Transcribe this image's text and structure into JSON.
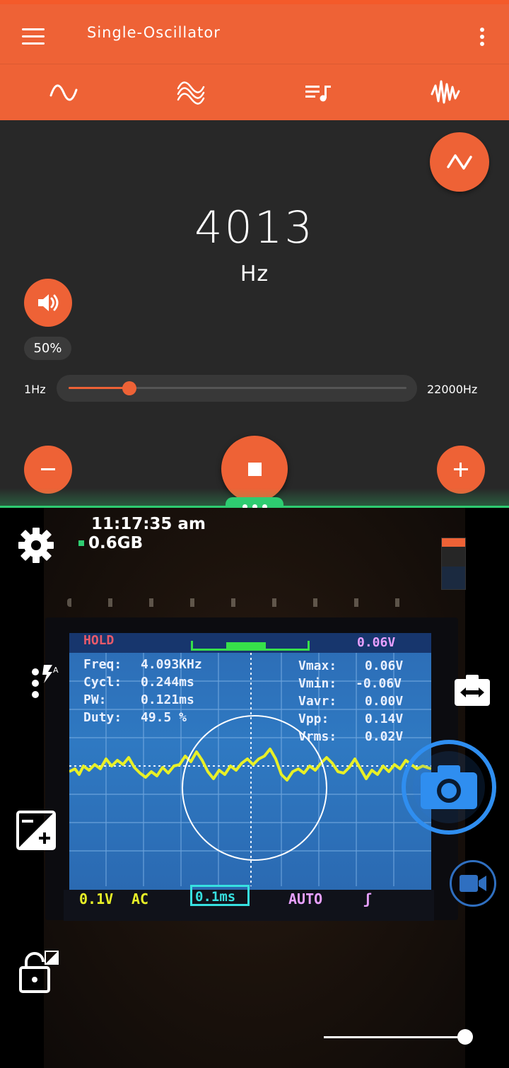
{
  "app_bar": {
    "title": "Single-Oscillator",
    "menu_icon": "hamburger-menu-icon",
    "overflow_icon": "more-vertical-icon",
    "accent_color": "#ee6236"
  },
  "tabs": [
    {
      "icon": "sine-wave-icon",
      "selected": true
    },
    {
      "icon": "multi-wave-icon",
      "selected": false
    },
    {
      "icon": "playlist-music-icon",
      "selected": false
    },
    {
      "icon": "noise-wave-icon",
      "selected": false
    }
  ],
  "oscillator": {
    "waveform_button_icon": "triangle-wave-icon",
    "frequency": "4013",
    "unit": "Hz",
    "volume_icon": "speaker-icon",
    "volume_percent": "50%",
    "slider_min_label": "1Hz",
    "slider_max_label": "22000Hz",
    "slider_fraction": 0.18,
    "minus_icon": "minus-icon",
    "stop_icon": "stop-icon",
    "plus_icon": "plus-icon"
  },
  "divider": {
    "color": "#2ecc71",
    "handle_icon": "drag-handle-icon"
  },
  "camera": {
    "time": "11:17:35 am",
    "memory": "0.6GB",
    "settings_icon": "gear-icon",
    "flash_icon": "flash-auto-icon",
    "exposure_icon": "exposure-icon",
    "lock_icon": "lock-icon",
    "switch_camera_icon": "switch-camera-icon",
    "shutter_icon": "camera-icon",
    "video_icon": "video-camera-icon",
    "zoom_fraction": 1.0,
    "scope": {
      "hold": "HOLD",
      "top_right": "0.06V",
      "freq_label": "Freq:",
      "freq_value": "4.093KHz",
      "cycl_label": "Cycl:",
      "cycl_value": "0.244ms",
      "pw_label": "PW:",
      "pw_value": "0.121ms",
      "duty_label": "Duty:",
      "duty_value": "49.5 %",
      "vmax_label": "Vmax:",
      "vmax_value": "0.06V",
      "vmin_label": "Vmin:",
      "vmin_value": "-0.06V",
      "vavr_label": "Vavr:",
      "vavr_value": "0.00V",
      "vpp_label": "Vpp:",
      "vpp_value": "0.14V",
      "vrms_label": "Vrms:",
      "vrms_value": "0.02V",
      "volt_div": "0.1V",
      "coupling": "AC",
      "time_div": "0.1ms",
      "trigger_mode": "AUTO"
    }
  }
}
